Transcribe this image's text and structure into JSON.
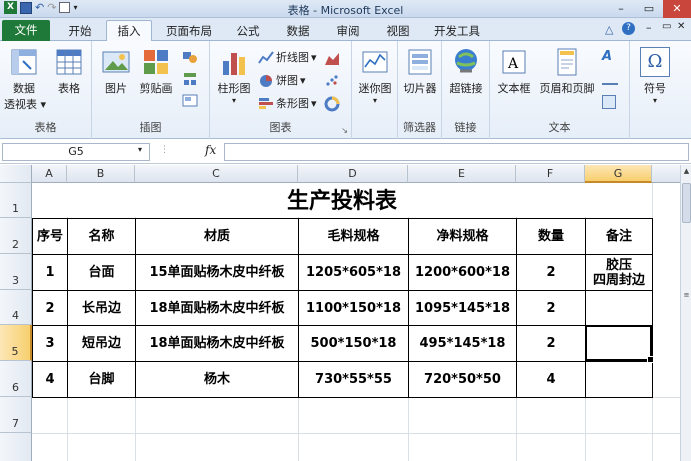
{
  "window": {
    "title": "表格 - Microsoft Excel"
  },
  "tabs": [
    {
      "label": "文件"
    },
    {
      "label": "开始"
    },
    {
      "label": "插入"
    },
    {
      "label": "页面布局"
    },
    {
      "label": "公式"
    },
    {
      "label": "数据"
    },
    {
      "label": "审阅"
    },
    {
      "label": "视图"
    },
    {
      "label": "开发工具"
    }
  ],
  "ribbon": {
    "groups": {
      "tables": "表格",
      "illustrations": "插图",
      "charts": "图表",
      "sparklines": "迷你图",
      "filter": "筛选器",
      "links": "链接",
      "text": "文本",
      "symbols": "符号"
    },
    "buttons": {
      "pivot_line1": "数据",
      "pivot_line2": "透视表",
      "table": "表格",
      "picture": "图片",
      "clipart": "剪贴画",
      "column_chart": "柱形图",
      "line_chart": "折线图",
      "pie_chart": "饼图",
      "bar_chart": "条形图",
      "sparkline": "迷你图",
      "slicer": "切片器",
      "hyperlink": "超链接",
      "textbox": "文本框",
      "header_footer": "页眉和页脚",
      "symbol": "符号",
      "sym_glyph": "Ω"
    }
  },
  "formula_bar": {
    "cell_ref": "G5",
    "fx": "fx",
    "value": ""
  },
  "columns": [
    "A",
    "B",
    "C",
    "D",
    "E",
    "F",
    "G"
  ],
  "rows": [
    "1",
    "2",
    "3",
    "4",
    "5",
    "6",
    "7"
  ],
  "sheet": {
    "title": "生产投料表",
    "headers": [
      "序号",
      "名称",
      "材质",
      "毛料规格",
      "净料规格",
      "数量",
      "备注"
    ],
    "rows": [
      [
        "1",
        "台面",
        "15单面贴杨木皮中纤板",
        "1205*605*18",
        "1200*600*18",
        "2",
        "胶压\n四周封边"
      ],
      [
        "2",
        "长吊边",
        "18单面贴杨木皮中纤板",
        "1100*150*18",
        "1095*145*18",
        "2",
        ""
      ],
      [
        "3",
        "短吊边",
        "18单面贴杨木皮中纤板",
        "500*150*18",
        "495*145*18",
        "2",
        ""
      ],
      [
        "4",
        "台脚",
        "杨木",
        "730*55*55",
        "720*50*50",
        "4",
        ""
      ]
    ]
  }
}
